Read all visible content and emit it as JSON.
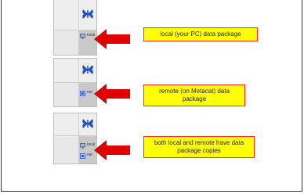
{
  "colors": {
    "callout_background": "#ffff00",
    "callout_border": "#ff2a2a",
    "arrow": "#e00000",
    "butterfly": "#1b4fd6",
    "frame_border": "#333333"
  },
  "panels": [
    {
      "status": {
        "label": "local",
        "icon": "computer-icon"
      },
      "callout": "local (your PC) data package"
    },
    {
      "status": {
        "label": "net",
        "icon": "network-icon"
      },
      "callout": "remote (on Metacat) data package"
    },
    {
      "status_items": [
        {
          "label": "local",
          "icon": "computer-icon"
        },
        {
          "label": "net",
          "icon": "network-icon"
        }
      ],
      "callout": "both local and remote have data package copies"
    }
  ]
}
